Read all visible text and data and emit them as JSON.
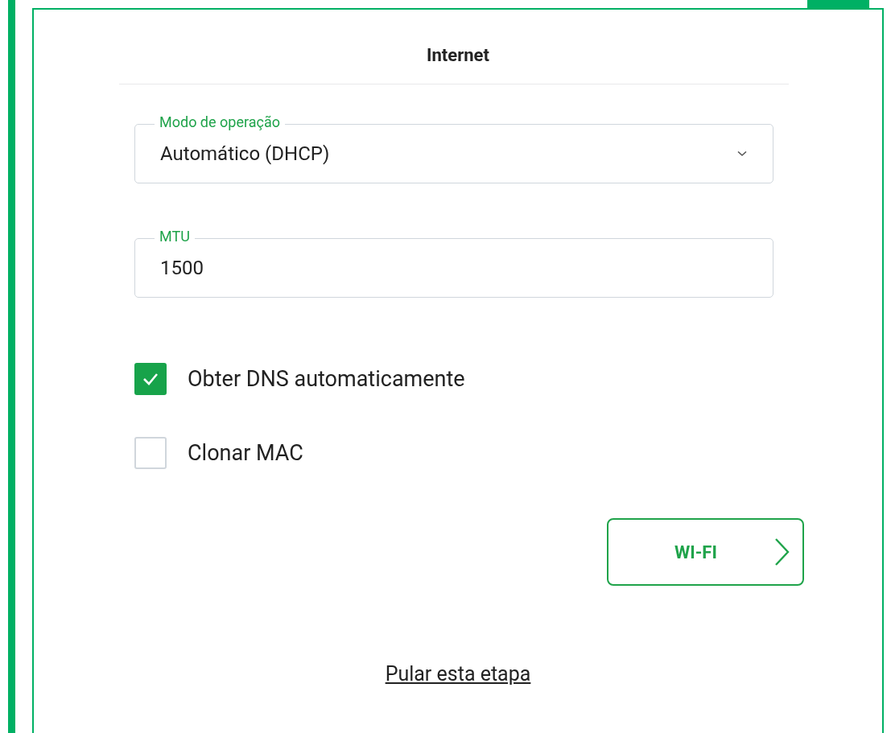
{
  "title": "Internet",
  "fields": [
    {
      "kind": "select",
      "label": "Modo de operação",
      "value": "Automático (DHCP)"
    },
    {
      "kind": "text",
      "label": "MTU",
      "value": "1500"
    }
  ],
  "checkboxes": [
    {
      "label": "Obter DNS automaticamente",
      "checked": true
    },
    {
      "label": "Clonar MAC",
      "checked": false
    }
  ],
  "next_button": {
    "label": "WI-FI"
  },
  "skip_link": "Pular esta etapa"
}
